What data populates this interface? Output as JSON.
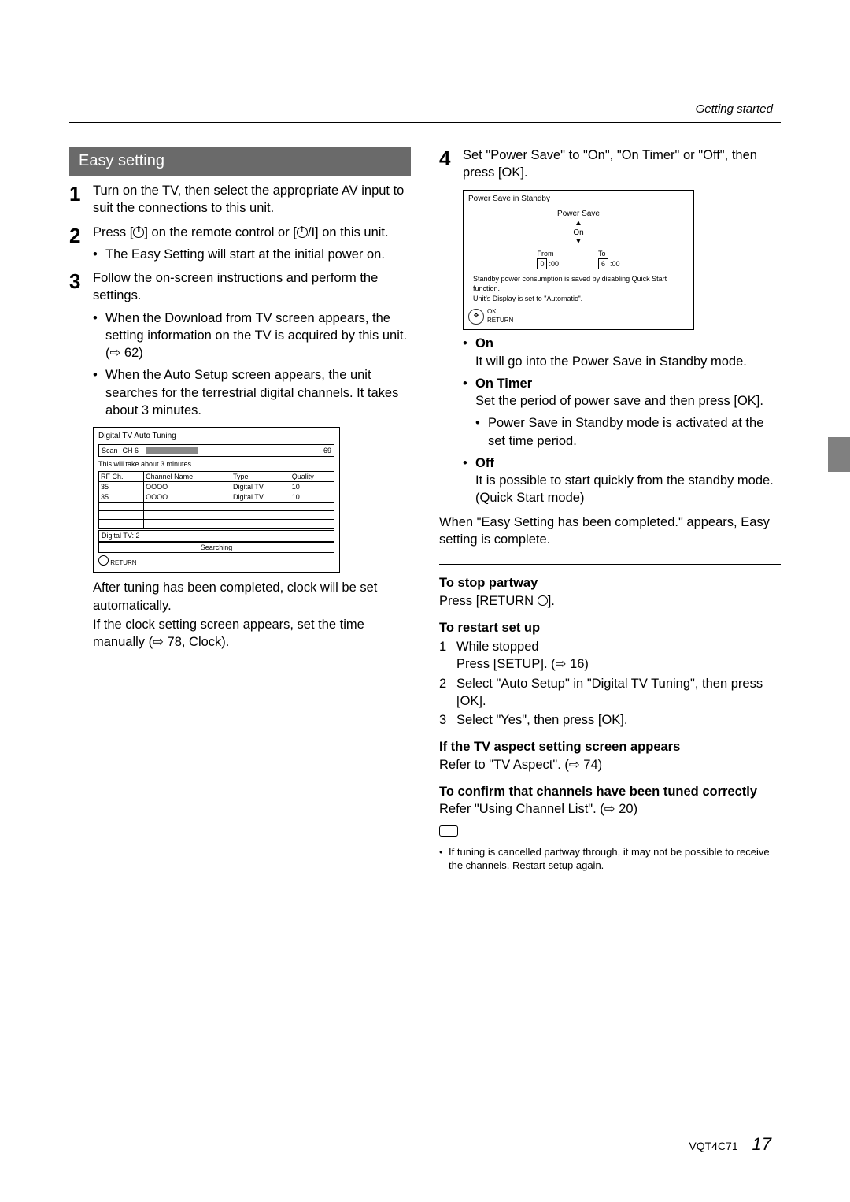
{
  "header": {
    "section": "Getting started"
  },
  "left": {
    "title": "Easy setting",
    "step1": "Turn on the TV, then select the appropriate AV input to suit the connections to this unit.",
    "step2_a": "Press [",
    "step2_b": "] on the remote control or [",
    "step2_c": "/I] on this unit.",
    "step2_bullet": "The Easy Setting will start at the initial power on.",
    "step3": "Follow the on-screen instructions and perform the settings.",
    "step3_b1": "When the Download from TV screen appears, the setting information on the TV is acquired by this unit. (⇨ 62)",
    "step3_b2": "When the Auto Setup screen appears, the unit searches for the terrestrial digital channels. It takes about 3 minutes.",
    "tuning": {
      "title": "Digital TV Auto Tuning",
      "scan": "Scan",
      "ch": "CH 6",
      "chn": "69",
      "note": "This will take about 3 minutes.",
      "headers": [
        "RF Ch.",
        "Channel Name",
        "Type",
        "Quality"
      ],
      "rows": [
        [
          "35",
          "OOOO",
          "Digital TV",
          "10"
        ],
        [
          "35",
          "OOOO",
          "Digital TV",
          "10"
        ]
      ],
      "dig": "Digital TV: 2",
      "searching": "Searching",
      "return": "RETURN"
    },
    "after1": "After tuning has been completed, clock will be set automatically.",
    "after2": "If the clock setting screen appears, set the time manually (⇨ 78, Clock)."
  },
  "right": {
    "step4": "Set \"Power Save\" to \"On\", \"On Timer\" or \"Off\", then press [OK].",
    "power": {
      "title": "Power Save in Standby",
      "label": "Power Save",
      "value": "On",
      "from": "From",
      "to": "To",
      "from_h": "0",
      "to_h": "6",
      "min": ":00",
      "note1": "Standby power consumption is saved by disabling Quick Start function.",
      "note2": "Unit's Display is set to \"Automatic\".",
      "ok": "OK",
      "ret": "RETURN"
    },
    "on_h": "On",
    "on_t": "It will go into the Power Save in Standby mode.",
    "ontimer_h": "On Timer",
    "ontimer_t": "Set the period of power save and then press [OK].",
    "ontimer_b": "Power Save in Standby mode is activated at the set time period.",
    "off_h": "Off",
    "off_t": "It is possible to start quickly from the standby mode. (Quick Start mode)",
    "complete": "When \"Easy Setting has been completed.\" appears, Easy setting is complete.",
    "stop_h": "To stop partway",
    "stop_t": "Press [RETURN ",
    "stop_t2": "].",
    "restart_h": "To restart set up",
    "restart": [
      {
        "n": "1",
        "a": "While stopped",
        "b": "Press [SETUP]. (⇨ 16)"
      },
      {
        "n": "2",
        "a": "Select \"Auto Setup\" in \"Digital TV Tuning\", then press [OK]."
      },
      {
        "n": "3",
        "a": "Select \"Yes\", then press [OK]."
      }
    ],
    "aspect_h": "If the TV aspect setting screen appears",
    "aspect_t": "Refer to \"TV Aspect\". (⇨ 74)",
    "confirm_h": "To confirm that channels have been tuned correctly",
    "confirm_t": "Refer \"Using Channel List\". (⇨ 20)",
    "footnote": "If tuning is cancelled partway through, it may not be possible to receive the channels. Restart setup again."
  },
  "footer": {
    "code": "VQT4C71",
    "page": "17"
  }
}
